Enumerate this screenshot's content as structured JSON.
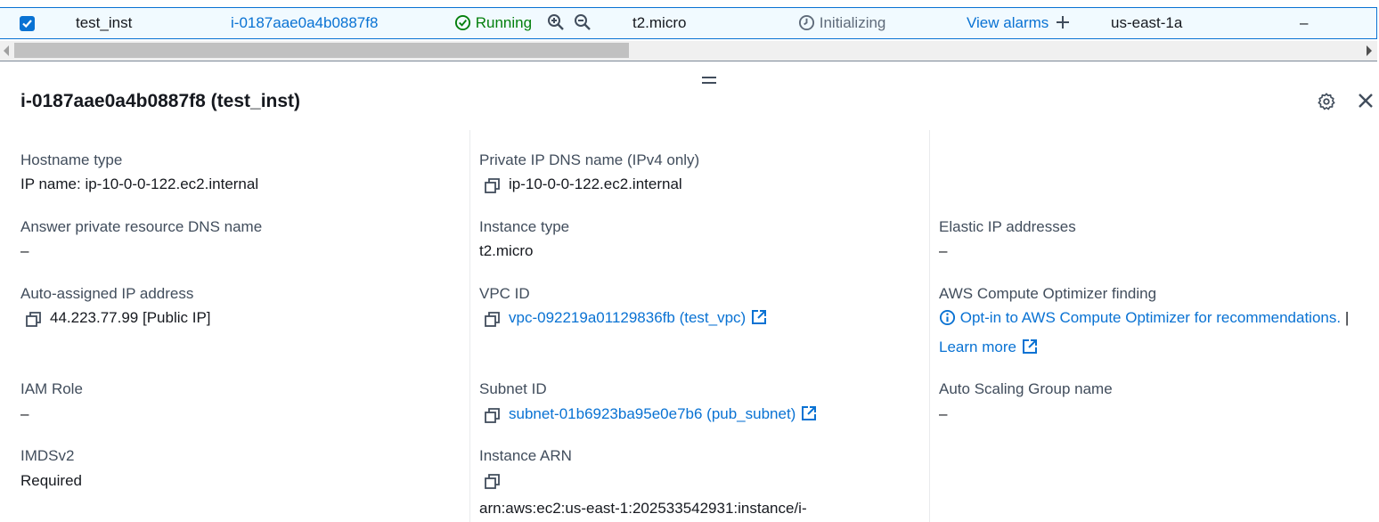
{
  "instances_row": {
    "name": "test_inst",
    "instance_id": "i-0187aae0a4b0887f8",
    "state": "Running",
    "instance_type": "t2.micro",
    "status_check": "Initializing",
    "alarm_link": "View alarms",
    "availability_zone": "us-east-1a",
    "public_dns": "–"
  },
  "details": {
    "title": "i-0187aae0a4b0887f8 (test_inst)",
    "col1": {
      "hostname_type_label": "Hostname type",
      "hostname_type_value": "IP name: ip-10-0-0-122.ec2.internal",
      "answer_dns_label": "Answer private resource DNS name",
      "answer_dns_value": "–",
      "auto_ip_label": "Auto-assigned IP address",
      "auto_ip_value": "44.223.77.99 [Public IP]",
      "iam_label": "IAM Role",
      "iam_value": "–",
      "imds_label": "IMDSv2",
      "imds_value": "Required"
    },
    "col2": {
      "private_dns_label": "Private IP DNS name (IPv4 only)",
      "private_dns_value": "ip-10-0-0-122.ec2.internal",
      "instance_type_label": "Instance type",
      "instance_type_value": "t2.micro",
      "vpc_label": "VPC ID",
      "vpc_value": "vpc-092219a01129836fb (test_vpc)",
      "subnet_label": "Subnet ID",
      "subnet_value": "subnet-01b6923ba95e0e7b6 (pub_subnet)",
      "arn_label": "Instance ARN",
      "arn_value": "arn:aws:ec2:us-east-1:202533542931:instance/i-"
    },
    "col3": {
      "eip_label": "Elastic IP addresses",
      "eip_value": "–",
      "optimizer_label": "AWS Compute Optimizer finding",
      "optimizer_link": "Opt-in to AWS Compute Optimizer for recommendations.",
      "optimizer_sep": "|",
      "learn_more": "Learn more",
      "asg_label": "Auto Scaling Group name",
      "asg_value": "–"
    }
  },
  "colors": {
    "link": "#0972d3",
    "running": "#037f0c",
    "selected_row_bg": "#f1faff",
    "muted": "#5f6b7a"
  },
  "icons": [
    "checkbox-checked-icon",
    "status-running-icon",
    "zoom-in-icon",
    "zoom-out-icon",
    "status-pending-icon",
    "plus-icon",
    "gear-icon",
    "close-icon",
    "copy-icon",
    "external-link-icon",
    "info-icon"
  ]
}
